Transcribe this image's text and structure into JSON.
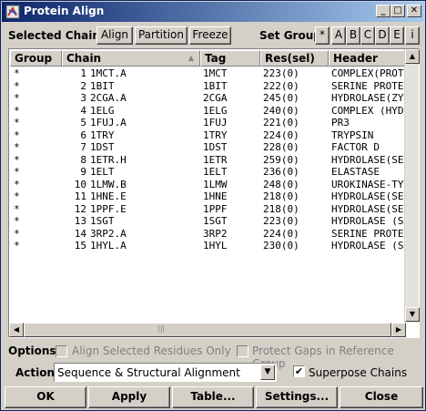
{
  "window": {
    "title": "Protein Align",
    "min_glyph": "_",
    "max_glyph": "□",
    "close_glyph": "✕",
    "icon": "app-icon"
  },
  "toolbar": {
    "selected_chains_label": "Selected Chains:",
    "align_label": "Align",
    "partition_label": "Partition",
    "freeze_label": "Freeze",
    "set_group_label": "Set Group:",
    "groups": [
      "*",
      "A",
      "B",
      "C",
      "D",
      "E",
      "i"
    ]
  },
  "table": {
    "columns": [
      "Group",
      "Chain",
      "Tag",
      "Res(sel)",
      "Header"
    ],
    "sort_glyph": "▲",
    "rows": [
      {
        "group": "*",
        "num": "1",
        "chain": "1MCT.A",
        "tag": "1MCT",
        "res": "223(0)",
        "header": "COMPLEX(PROT"
      },
      {
        "group": "*",
        "num": "2",
        "chain": "1BIT",
        "tag": "1BIT",
        "res": "222(0)",
        "header": "SERINE PROTE"
      },
      {
        "group": "*",
        "num": "3",
        "chain": "2CGA.A",
        "tag": "2CGA",
        "res": "245(0)",
        "header": "HYDROLASE(ZY"
      },
      {
        "group": "*",
        "num": "4",
        "chain": "1ELG",
        "tag": "1ELG",
        "res": "240(0)",
        "header": "COMPLEX (HYD"
      },
      {
        "group": "*",
        "num": "5",
        "chain": "1FUJ.A",
        "tag": "1FUJ",
        "res": "221(0)",
        "header": "PR3"
      },
      {
        "group": "*",
        "num": "6",
        "chain": "1TRY",
        "tag": "1TRY",
        "res": "224(0)",
        "header": "TRYPSIN"
      },
      {
        "group": "*",
        "num": "7",
        "chain": "1DST",
        "tag": "1DST",
        "res": "228(0)",
        "header": "FACTOR D"
      },
      {
        "group": "*",
        "num": "8",
        "chain": "1ETR.H",
        "tag": "1ETR",
        "res": "259(0)",
        "header": "HYDROLASE(SE"
      },
      {
        "group": "*",
        "num": "9",
        "chain": "1ELT",
        "tag": "1ELT",
        "res": "236(0)",
        "header": "ELASTASE"
      },
      {
        "group": "*",
        "num": "10",
        "chain": "1LMW.B",
        "tag": "1LMW",
        "res": "248(0)",
        "header": "UROKINASE-TY"
      },
      {
        "group": "*",
        "num": "11",
        "chain": "1HNE.E",
        "tag": "1HNE",
        "res": "218(0)",
        "header": "HYDROLASE(SE"
      },
      {
        "group": "*",
        "num": "12",
        "chain": "1PPF.E",
        "tag": "1PPF",
        "res": "218(0)",
        "header": "HYDROLASE(SE"
      },
      {
        "group": "*",
        "num": "13",
        "chain": "1SGT",
        "tag": "1SGT",
        "res": "223(0)",
        "header": "HYDROLASE (S"
      },
      {
        "group": "*",
        "num": "14",
        "chain": "3RP2.A",
        "tag": "3RP2",
        "res": "224(0)",
        "header": "SERINE PROTE"
      },
      {
        "group": "*",
        "num": "15",
        "chain": "1HYL.A",
        "tag": "1HYL",
        "res": "230(0)",
        "header": "HYDROLASE (S"
      }
    ],
    "scroll_up": "▲",
    "scroll_down": "▼",
    "scroll_left": "◀",
    "scroll_right": "▶",
    "grip": "|||"
  },
  "options": {
    "label": "Options:",
    "align_selected": "Align Selected Residues Only",
    "protect_gaps": "Protect Gaps in Reference Group"
  },
  "action": {
    "label": "Action:",
    "value": "Sequence & Structural Alignment",
    "arrow": "▼",
    "superpose_label": "Superpose Chains",
    "superpose_checked": "✔"
  },
  "buttons": {
    "ok": "OK",
    "apply": "Apply",
    "table": "Table...",
    "settings": "Settings...",
    "close": "Close"
  }
}
